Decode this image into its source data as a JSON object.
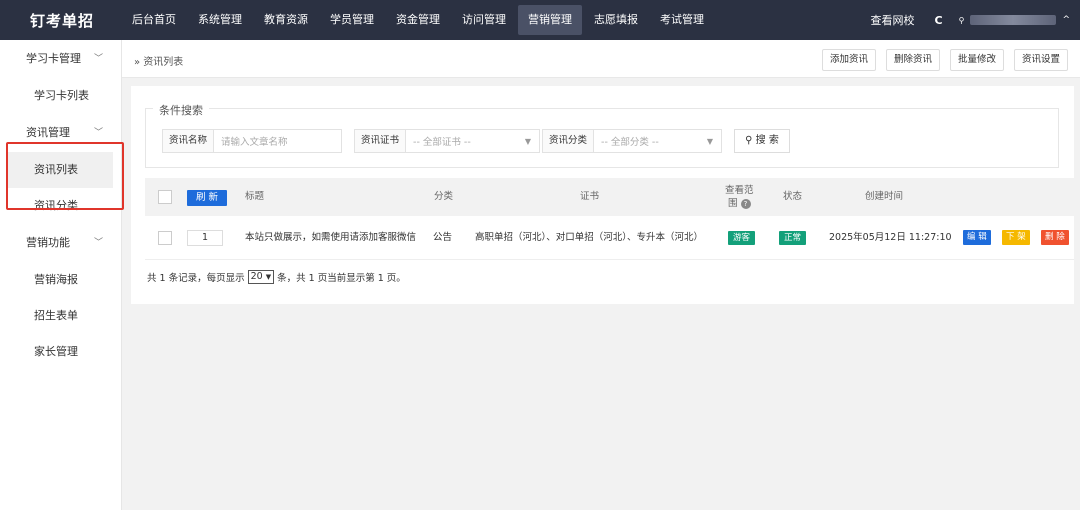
{
  "app": {
    "logo": "钉考单招"
  },
  "nav": [
    {
      "label": "后台首页"
    },
    {
      "label": "系统管理"
    },
    {
      "label": "教育资源"
    },
    {
      "label": "学员管理"
    },
    {
      "label": "资金管理"
    },
    {
      "label": "访问管理"
    },
    {
      "label": "营销管理",
      "active": true
    },
    {
      "label": "志愿填报"
    },
    {
      "label": "考试管理"
    }
  ],
  "top_right": {
    "view_site": "查看网校",
    "refresh_icon": "refresh-icon",
    "user_icon": "user-icon",
    "caret_icon": "chevron-up-icon"
  },
  "sidebar": {
    "groups": [
      {
        "label": "学习卡管理",
        "items": [
          "学习卡列表"
        ]
      },
      {
        "label": "资讯管理",
        "items": [
          "资讯列表",
          "资讯分类"
        ]
      },
      {
        "label": "营销功能",
        "items": [
          "营销海报",
          "招生表单",
          "家长管理"
        ]
      }
    ],
    "active_item": "资讯列表"
  },
  "breadcrumb": "» 资讯列表",
  "toolbar": {
    "add": "添加资讯",
    "delete": "删除资讯",
    "batch": "批量修改",
    "settings": "资讯设置"
  },
  "search": {
    "legend": "条件搜索",
    "name_label": "资讯名称",
    "name_placeholder": "请输入文章名称",
    "cert_label": "资讯证书",
    "cert_value": "-- 全部证书 --",
    "cat_label": "资讯分类",
    "cat_value": "-- 全部分类 --",
    "button": "搜 索"
  },
  "table": {
    "refresh": "刷 新",
    "headers": {
      "title": "标题",
      "category": "分类",
      "cert": "证书",
      "scope_line1": "查看范",
      "scope_line2": "围",
      "status": "状态",
      "created": "创建时间"
    },
    "rows": [
      {
        "order": "1",
        "title": "本站只做展示，如需使用请添加客服微信",
        "category": "公告",
        "cert": "高职单招（河北）、对口单招（河北）、专升本（河北）",
        "scope": "游客",
        "status": "正常",
        "created": "2025年05月12日 11:27:10",
        "actions": {
          "edit": "编 辑",
          "offline": "下 架",
          "delete": "删 除"
        }
      }
    ]
  },
  "pager": {
    "prefix": "共 1 条记录，每页显示",
    "page_size": "20",
    "suffix": "条，共 1 页当前显示第 1 页。"
  },
  "colors": {
    "topbar": "#2b3142",
    "primary": "#1e6cdb",
    "green": "#13a07a",
    "orange": "#f5b800",
    "red": "#f0522f",
    "highlight": "#e0352b"
  }
}
